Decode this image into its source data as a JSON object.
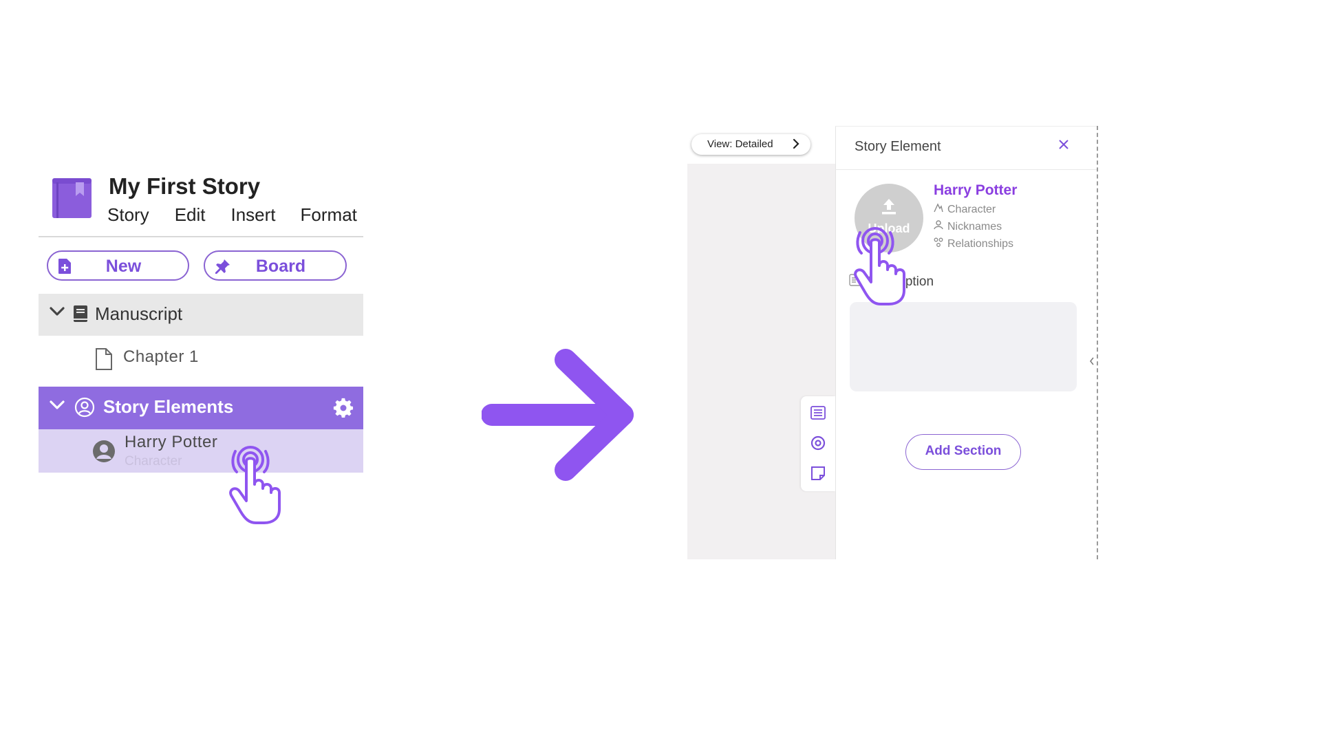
{
  "left": {
    "app_title": "My First Story",
    "menu": [
      "Story",
      "Edit",
      "Insert",
      "Format"
    ],
    "buttons": {
      "new_label": "New",
      "board_label": "Board"
    },
    "tree": {
      "manuscript_label": "Manuscript",
      "chapter_label": "Chapter 1",
      "story_elements_label": "Story Elements",
      "element_name": "Harry Potter",
      "element_type": "Character"
    },
    "icons": [
      "book-icon",
      "new-doc-icon",
      "pin-icon",
      "chevron-down-icon",
      "manuscript-book-icon",
      "document-icon",
      "user-circle-icon",
      "gear-icon",
      "avatar-icon",
      "tap-hand-icon"
    ]
  },
  "right": {
    "view_label": "View: Detailed",
    "panel_title": "Story Element",
    "upload_label": "Upload",
    "element_name": "Harry Potter",
    "meta": {
      "type": "Character",
      "nicknames": "Nicknames",
      "relationships": "Relationships"
    },
    "description_label": "Description",
    "add_section_label": "Add Section",
    "toolbar_icons": [
      "list-icon",
      "target-icon",
      "note-icon"
    ]
  },
  "colors": {
    "accent": "#8f6ce0",
    "accent_dark": "#7b4fdb",
    "selected_row": "#dcd3f3",
    "name_purple": "#8a3ee0",
    "arrow": "#8f55f0"
  }
}
